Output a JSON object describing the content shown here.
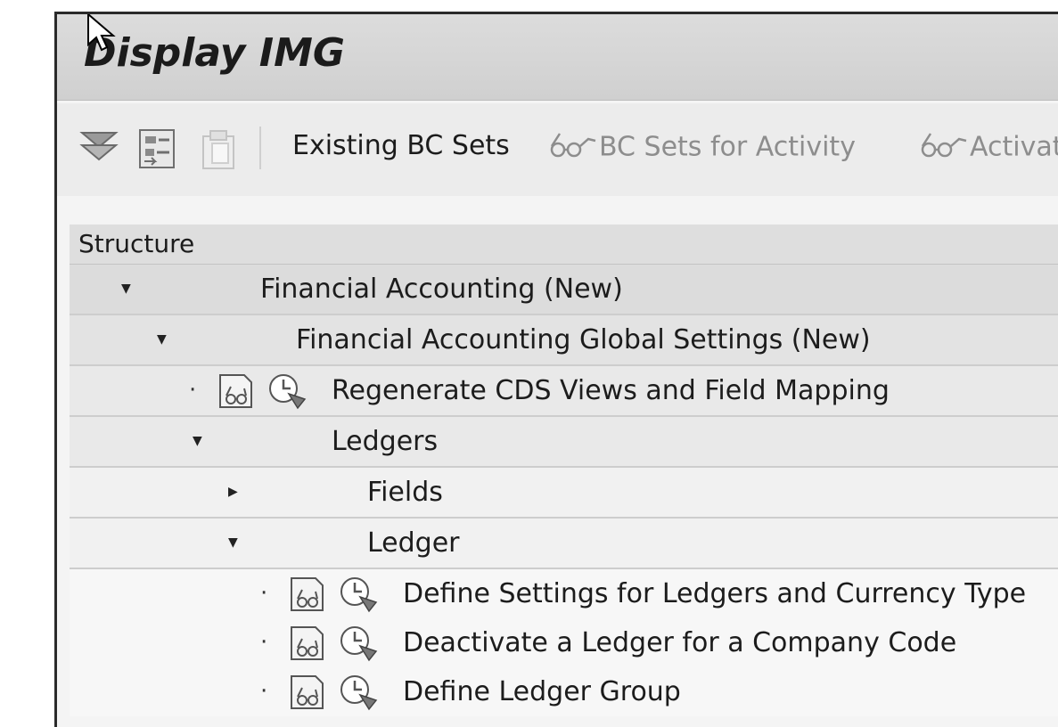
{
  "window": {
    "title": "Display IMG"
  },
  "toolbar": {
    "buttons": [
      {
        "label": "Existing BC Sets",
        "state": "enabled"
      },
      {
        "label": "BC Sets for Activity",
        "state": "disabled"
      },
      {
        "label": "Activat",
        "state": "disabled"
      }
    ],
    "icons": [
      "expand-all-icon",
      "document-list-icon",
      "clipboard-icon"
    ]
  },
  "tree": {
    "header": "Structure",
    "nodes": [
      {
        "label": "Financial Accounting (New)",
        "level": 0,
        "type": "folder",
        "expanded": true
      },
      {
        "label": "Financial Accounting Global Settings (New)",
        "level": 1,
        "type": "folder",
        "expanded": true
      },
      {
        "label": "Regenerate CDS Views and Field Mapping",
        "level": 2,
        "type": "activity"
      },
      {
        "label": "Ledgers",
        "level": 2,
        "type": "folder",
        "expanded": true
      },
      {
        "label": "Fields",
        "level": 3,
        "type": "folder",
        "expanded": false
      },
      {
        "label": "Ledger",
        "level": 3,
        "type": "folder",
        "expanded": true
      },
      {
        "label": "Define Settings for Ledgers and Currency Type",
        "level": 4,
        "type": "activity"
      },
      {
        "label": "Deactivate a Ledger for a Company Code",
        "level": 4,
        "type": "activity"
      },
      {
        "label": "Define Ledger Group",
        "level": 4,
        "type": "activity"
      }
    ]
  }
}
